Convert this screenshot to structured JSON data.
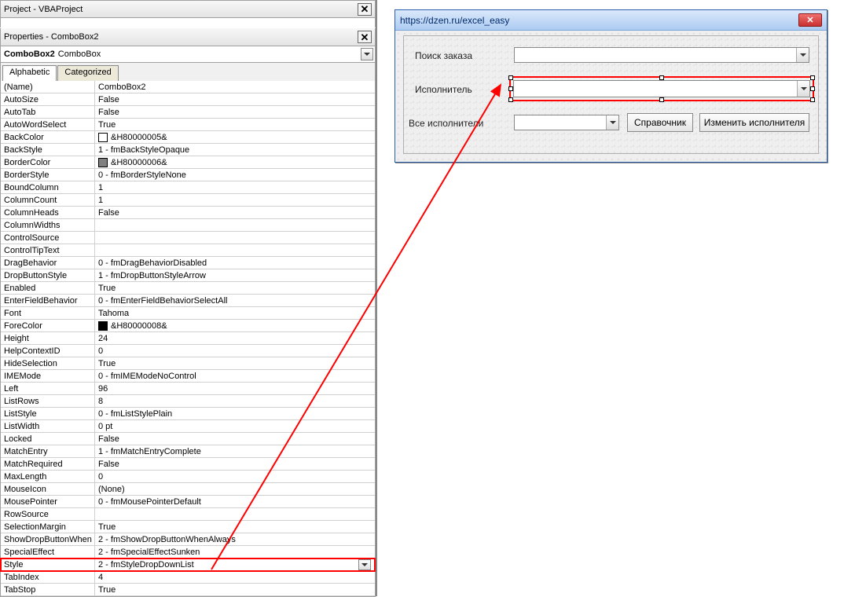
{
  "project_pane": {
    "title": "Project - VBAProject"
  },
  "props_pane": {
    "title": "Properties - ComboBox2",
    "object_name": "ComboBox2",
    "object_type": "ComboBox",
    "tabs": {
      "alphabetic": "Alphabetic",
      "categorized": "Categorized"
    },
    "rows": [
      {
        "name": "(Name)",
        "value": "ComboBox2"
      },
      {
        "name": "AutoSize",
        "value": "False"
      },
      {
        "name": "AutoTab",
        "value": "False"
      },
      {
        "name": "AutoWordSelect",
        "value": "True"
      },
      {
        "name": "BackColor",
        "value": "&H80000005&",
        "swatch": "#ffffff"
      },
      {
        "name": "BackStyle",
        "value": "1 - fmBackStyleOpaque"
      },
      {
        "name": "BorderColor",
        "value": "&H80000006&",
        "swatch": "#808080"
      },
      {
        "name": "BorderStyle",
        "value": "0 - fmBorderStyleNone"
      },
      {
        "name": "BoundColumn",
        "value": "1"
      },
      {
        "name": "ColumnCount",
        "value": "1"
      },
      {
        "name": "ColumnHeads",
        "value": "False"
      },
      {
        "name": "ColumnWidths",
        "value": ""
      },
      {
        "name": "ControlSource",
        "value": ""
      },
      {
        "name": "ControlTipText",
        "value": ""
      },
      {
        "name": "DragBehavior",
        "value": "0 - fmDragBehaviorDisabled"
      },
      {
        "name": "DropButtonStyle",
        "value": "1 - fmDropButtonStyleArrow"
      },
      {
        "name": "Enabled",
        "value": "True"
      },
      {
        "name": "EnterFieldBehavior",
        "value": "0 - fmEnterFieldBehaviorSelectAll"
      },
      {
        "name": "Font",
        "value": "Tahoma"
      },
      {
        "name": "ForeColor",
        "value": "&H80000008&",
        "swatch": "#000000"
      },
      {
        "name": "Height",
        "value": "24"
      },
      {
        "name": "HelpContextID",
        "value": "0"
      },
      {
        "name": "HideSelection",
        "value": "True"
      },
      {
        "name": "IMEMode",
        "value": "0 - fmIMEModeNoControl"
      },
      {
        "name": "Left",
        "value": "96"
      },
      {
        "name": "ListRows",
        "value": "8"
      },
      {
        "name": "ListStyle",
        "value": "0 - fmListStylePlain"
      },
      {
        "name": "ListWidth",
        "value": "0 pt"
      },
      {
        "name": "Locked",
        "value": "False"
      },
      {
        "name": "MatchEntry",
        "value": "1 - fmMatchEntryComplete"
      },
      {
        "name": "MatchRequired",
        "value": "False"
      },
      {
        "name": "MaxLength",
        "value": "0"
      },
      {
        "name": "MouseIcon",
        "value": "(None)"
      },
      {
        "name": "MousePointer",
        "value": "0 - fmMousePointerDefault"
      },
      {
        "name": "RowSource",
        "value": ""
      },
      {
        "name": "SelectionMargin",
        "value": "True"
      },
      {
        "name": "ShowDropButtonWhen",
        "value": "2 - fmShowDropButtonWhenAlways"
      },
      {
        "name": "SpecialEffect",
        "value": "2 - fmSpecialEffectSunken"
      },
      {
        "name": "Style",
        "value": "2 - fmStyleDropDownList",
        "highlight": true
      },
      {
        "name": "TabIndex",
        "value": "4"
      },
      {
        "name": "TabStop",
        "value": "True"
      }
    ]
  },
  "userform": {
    "title": "https://dzen.ru/excel_easy",
    "labels": {
      "search_order": "Поиск заказа",
      "performer": "Исполнитель",
      "all_performers": "Все исполнители"
    },
    "buttons": {
      "reference": "Справочник",
      "change_performer": "Изменить исполнителя"
    }
  }
}
